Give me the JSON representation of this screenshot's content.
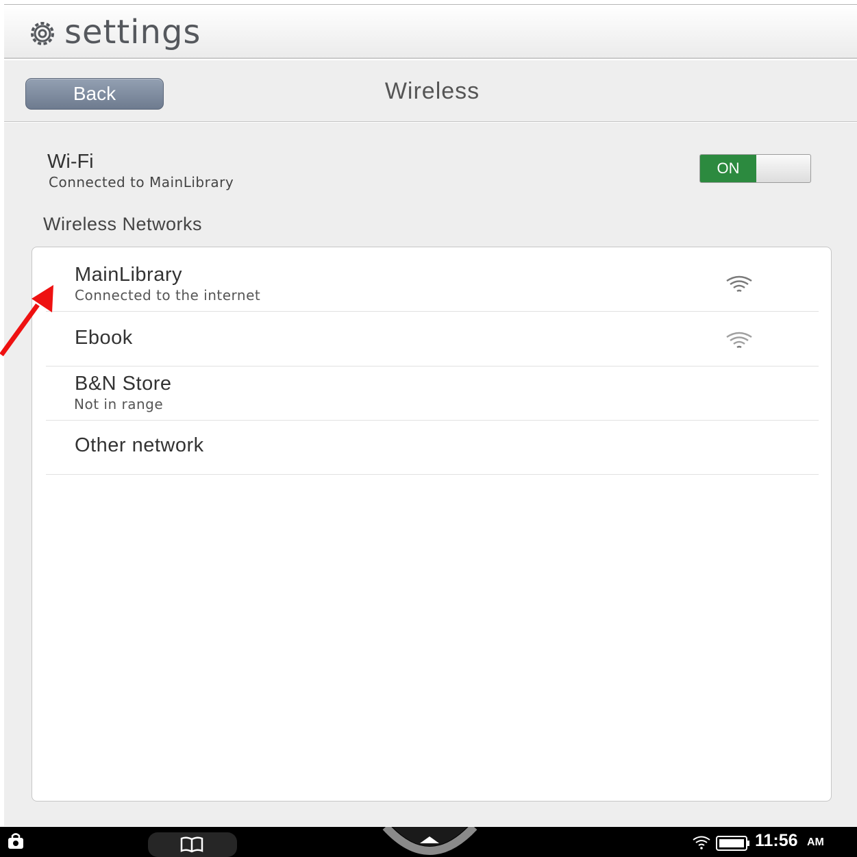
{
  "app": {
    "title": "settings",
    "icon": "gear-icon"
  },
  "header": {
    "back_label": "Back",
    "title": "Wireless"
  },
  "wifi": {
    "label": "Wi-Fi",
    "status": "Connected to MainLibrary",
    "toggle_label": "ON",
    "toggle_on_color": "#2c8a3f"
  },
  "networks": {
    "section_title": "Wireless Networks",
    "items": [
      {
        "name": "MainLibrary",
        "status": "Connected to the internet",
        "icon": "wifi-signal-icon"
      },
      {
        "name": "Ebook",
        "status": "",
        "icon": "wifi-signal-icon"
      },
      {
        "name": "B&N Store",
        "status": "Not in range",
        "icon": ""
      },
      {
        "name": "Other network",
        "status": "",
        "icon": ""
      }
    ]
  },
  "annotation": {
    "arrow_color": "#ee1111"
  },
  "statusbar": {
    "time": "11:56",
    "ampm": "AM"
  }
}
